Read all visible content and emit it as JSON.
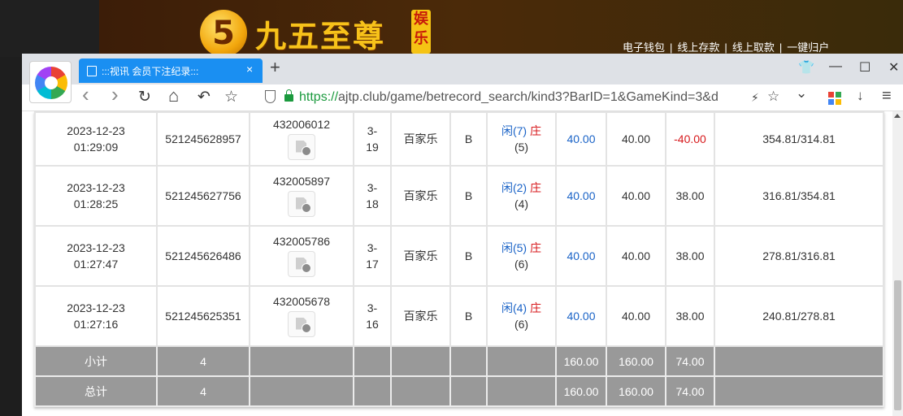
{
  "site": {
    "logo_mark": "5",
    "logo_text": "九五至尊",
    "logo_badge": "娱乐",
    "nav": [
      "电子钱包",
      "线上存款",
      "线上取款",
      "一键归户"
    ],
    "nav_sep": "|"
  },
  "browser": {
    "tab_title": ":::视讯 会员下注纪录:::",
    "tab_close": "×",
    "new_tab": "+",
    "url_scheme": "https://",
    "url_rest": "ajtp.club/game/betrecord_search/kind3?BarID=1&GameKind=3&d",
    "icons": {
      "back": "‹",
      "forward": "›",
      "reload": "↻",
      "home": "⌂",
      "undo": "↶",
      "star": "☆",
      "bolt": "⚡",
      "fav": "☆",
      "dropdown": "⌄",
      "download": "↓",
      "menu": "≡",
      "shirt": "👕",
      "minimize": "—",
      "maximize": "☐",
      "close": "✕"
    }
  },
  "records": [
    {
      "date": "2023-12-23",
      "time": "01:29:09",
      "order": "521245628957",
      "round": "432006012",
      "seat1": "3-",
      "seat2": "19",
      "game": "百家乐",
      "bet": "B",
      "xian_label": "闲(7)",
      "zhuang_label": "庄",
      "zhuang_pts": "(5)",
      "amount": "40.00",
      "valid": "40.00",
      "result": "-40.00",
      "balance": "354.81/314.81"
    },
    {
      "date": "2023-12-23",
      "time": "01:28:25",
      "order": "521245627756",
      "round": "432005897",
      "seat1": "3-",
      "seat2": "18",
      "game": "百家乐",
      "bet": "B",
      "xian_label": "闲(2)",
      "zhuang_label": "庄",
      "zhuang_pts": "(4)",
      "amount": "40.00",
      "valid": "40.00",
      "result": "38.00",
      "balance": "316.81/354.81"
    },
    {
      "date": "2023-12-23",
      "time": "01:27:47",
      "order": "521245626486",
      "round": "432005786",
      "seat1": "3-",
      "seat2": "17",
      "game": "百家乐",
      "bet": "B",
      "xian_label": "闲(5)",
      "zhuang_label": "庄",
      "zhuang_pts": "(6)",
      "amount": "40.00",
      "valid": "40.00",
      "result": "38.00",
      "balance": "278.81/316.81"
    },
    {
      "date": "2023-12-23",
      "time": "01:27:16",
      "order": "521245625351",
      "round": "432005678",
      "seat1": "3-",
      "seat2": "16",
      "game": "百家乐",
      "bet": "B",
      "xian_label": "闲(4)",
      "zhuang_label": "庄",
      "zhuang_pts": "(6)",
      "amount": "40.00",
      "valid": "40.00",
      "result": "38.00",
      "balance": "240.81/278.81"
    }
  ],
  "subtotal": {
    "label": "小计",
    "count": "4",
    "amount": "160.00",
    "valid": "160.00",
    "result": "74.00"
  },
  "total": {
    "label": "总计",
    "count": "4",
    "amount": "160.00",
    "valid": "160.00",
    "result": "74.00"
  },
  "colors": {
    "bet_blue": "#1a63c7",
    "loss_red": "#d7191c",
    "summary_gray": "#999999",
    "tab_blue": "#1a8ff2"
  }
}
